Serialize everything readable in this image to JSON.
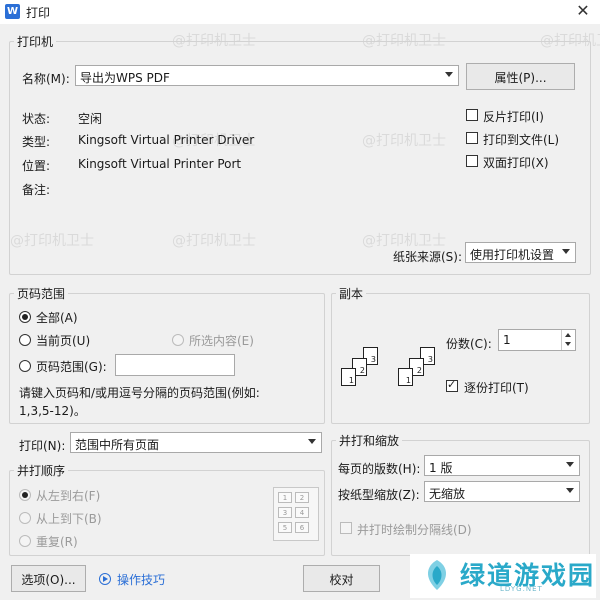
{
  "window": {
    "app_icon": "W",
    "title": "打印",
    "close_glyph": "✕"
  },
  "watermark": "@打印机卫士",
  "printer": {
    "group_label": "打印机",
    "name_label": "名称(M):",
    "name_value": "导出为WPS PDF",
    "properties_button": "属性(P)...",
    "status_label": "状态:",
    "status_value": "空闲",
    "type_label": "类型:",
    "type_value": "Kingsoft Virtual Printer Driver",
    "location_label": "位置:",
    "location_value": "Kingsoft Virtual Printer Port",
    "comment_label": "备注:",
    "reverse_print": "反片打印(I)",
    "print_to_file": "打印到文件(L)",
    "duplex": "双面打印(X)",
    "paper_source_label": "纸张来源(S):",
    "paper_source_value": "使用打印机设置"
  },
  "page_range": {
    "group_label": "页码范围",
    "all": "全部(A)",
    "current": "当前页(U)",
    "selection": "所选内容(E)",
    "range": "页码范围(G):",
    "range_value": "",
    "hint_line1": "请键入页码和/或用逗号分隔的页码范围(例如:",
    "hint_line2": "1,3,5-12)。"
  },
  "copies": {
    "group_label": "副本",
    "count_label": "份数(C):",
    "count_value": "1",
    "collate": "逐份打印(T)",
    "icons": [
      "3",
      "2",
      "1",
      "3",
      "2",
      "1"
    ]
  },
  "print_what": {
    "label": "打印(N):",
    "value": "范围中所有页面"
  },
  "merge_order": {
    "group_label": "并打顺序",
    "left_to_right": "从左到右(F)",
    "top_to_bottom": "从上到下(B)",
    "repeat": "重复(R)",
    "grid": [
      "1",
      "2",
      "3",
      "4",
      "5",
      "6"
    ]
  },
  "zoom": {
    "group_label": "并打和缩放",
    "pages_per_sheet_label": "每页的版数(H):",
    "pages_per_sheet_value": "1 版",
    "scale_label": "按纸型缩放(Z):",
    "scale_value": "无缩放",
    "draw_lines": "并打时绘制分隔线(D)"
  },
  "footer": {
    "options_button": "选项(O)...",
    "tips_link": "操作技巧",
    "proof_button": "校对"
  },
  "logo": {
    "text": "绿道游戏园",
    "sub": "LDYG.NET"
  },
  "colors": {
    "accent": "#2b6fd6",
    "logo": "#2aa9c9"
  }
}
